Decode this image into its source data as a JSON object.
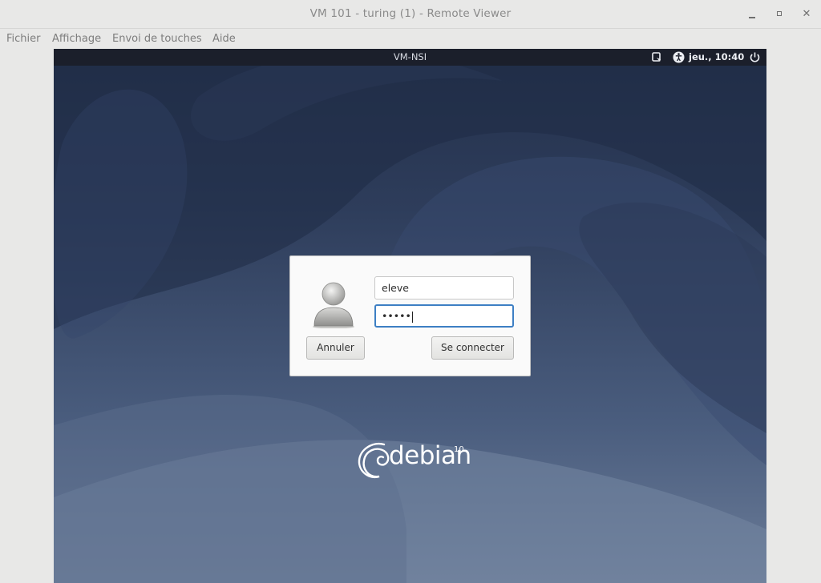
{
  "window": {
    "title": "VM 101 - turing (1) - Remote Viewer",
    "controls": {
      "minimize": "minimize",
      "maximize": "maximize",
      "close": "✕"
    }
  },
  "menubar": {
    "items": [
      "Fichier",
      "Affichage",
      "Envoi de touches",
      "Aide"
    ]
  },
  "vm": {
    "topbar": {
      "hostname": "VM-NSI",
      "clock": "jeu., 10:40",
      "icons": [
        "screen-keyboard-icon",
        "accessibility-icon",
        "power-icon"
      ]
    },
    "login": {
      "username": "eleve",
      "password_mask": "•••••",
      "cancel_label": "Annuler",
      "connect_label": "Se connecter"
    },
    "branding": {
      "name": "debian",
      "version": "10"
    }
  },
  "colors": {
    "focus_border": "#3d7fc4",
    "topbar_bg": "#1b1f2b",
    "wallpaper_top": "#23304b",
    "wallpaper_bottom": "#6b7c98"
  }
}
